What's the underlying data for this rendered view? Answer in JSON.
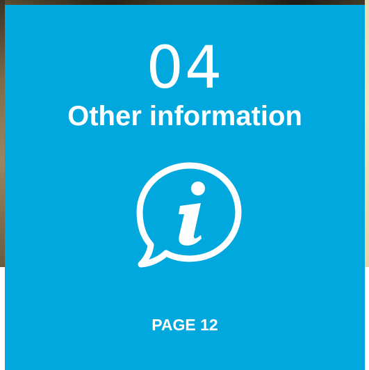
{
  "section": {
    "number": "04",
    "title": "Other information",
    "icon": "info-speech-bubble-icon",
    "page_label": "PAGE 12"
  },
  "colors": {
    "card_background": "#00a8de",
    "text": "#ffffff"
  }
}
